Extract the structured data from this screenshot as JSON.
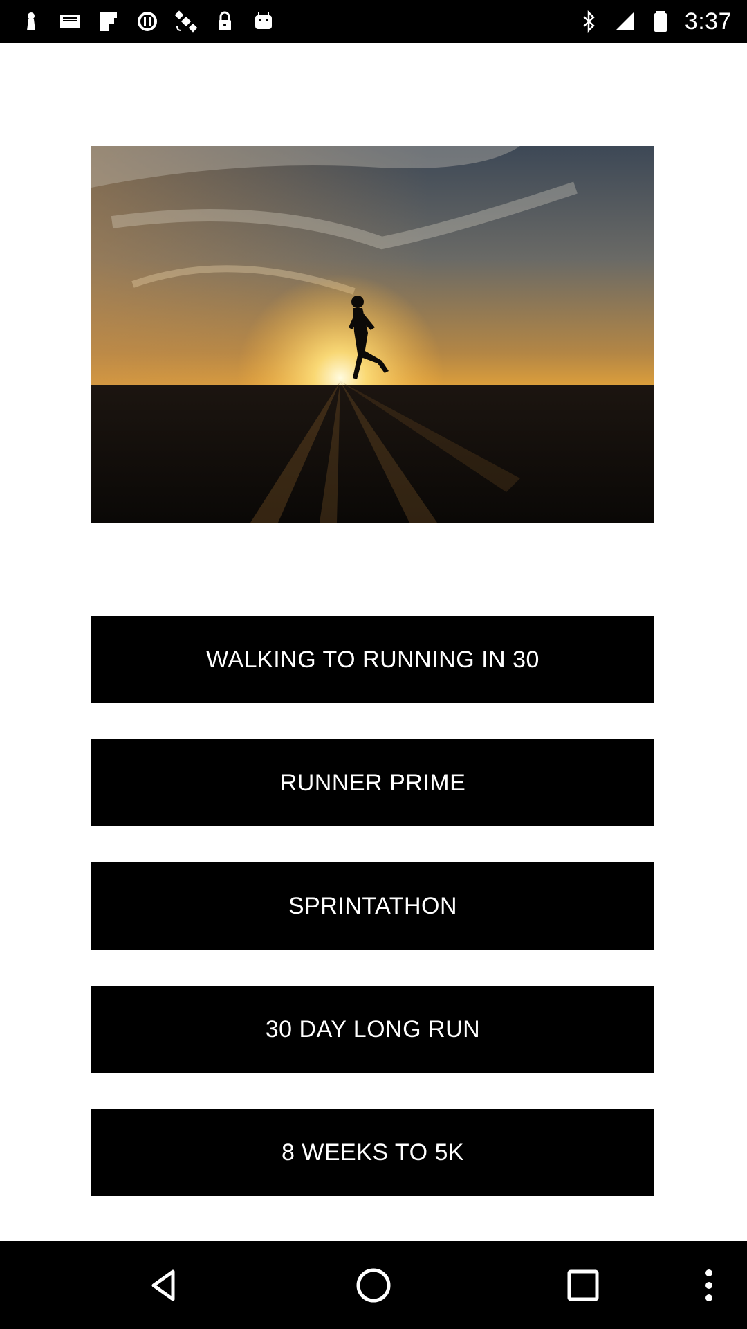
{
  "status_bar": {
    "time": "3:37",
    "left_icons": [
      "notification-icon",
      "mail-icon",
      "flipboard-icon",
      "alert-icon",
      "satellite-icon",
      "lock-icon",
      "android-icon"
    ],
    "right_icons": [
      "bluetooth-icon",
      "signal-icon",
      "battery-icon"
    ]
  },
  "hero": {
    "image": "runner-silhouette-sunset-photo"
  },
  "menu": {
    "items": [
      {
        "label": "WALKING TO RUNNING IN 30"
      },
      {
        "label": "RUNNER PRIME"
      },
      {
        "label": "SPRINTATHON"
      },
      {
        "label": "30 DAY LONG RUN"
      },
      {
        "label": "8 WEEKS TO 5K"
      }
    ]
  },
  "nav_bar": {
    "buttons": [
      "back-icon",
      "home-icon",
      "recents-icon",
      "overflow-menu-icon"
    ]
  },
  "colors": {
    "background": "#ffffff",
    "button_bg": "#000000",
    "button_text": "#ffffff",
    "bar_bg": "#000000"
  }
}
